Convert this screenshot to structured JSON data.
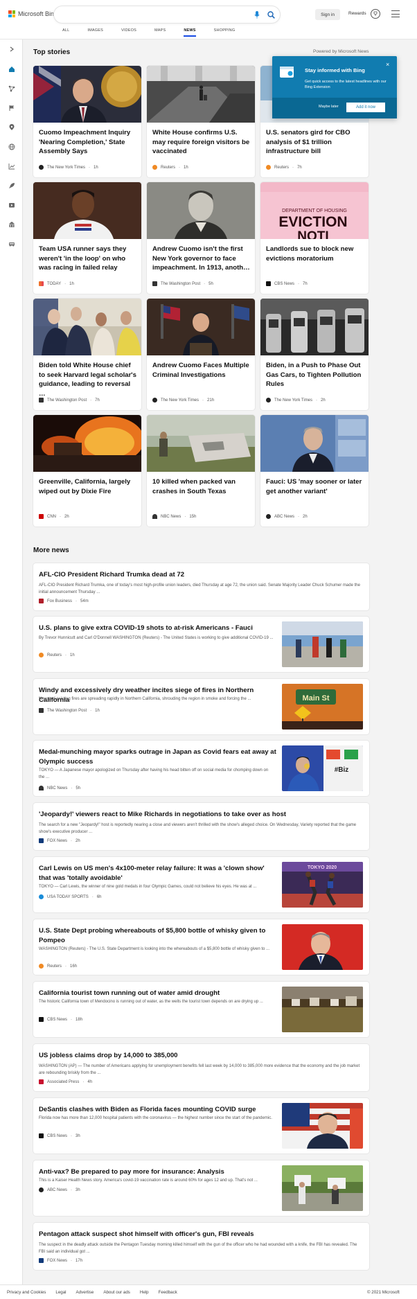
{
  "header": {
    "logo_text": "Microsoft Bing",
    "signin_label": "Sign in",
    "rewards_label": "Rewards",
    "tabs": [
      "ALL",
      "IMAGES",
      "VIDEOS",
      "MAPS",
      "NEWS",
      "SHOPPING"
    ],
    "active_tab": "NEWS"
  },
  "sections": {
    "top_stories": "Top stories",
    "powered_by": "Powered by Microsoft News",
    "more_news": "More news"
  },
  "promo": {
    "title": "Stay informed with Bing",
    "description": "Get quick access to the latest headlines with our Bing Extension",
    "later_label": "Maybe later",
    "add_label": "Add it now",
    "close_label": "×"
  },
  "top_stories": [
    {
      "title": "Cuomo Impeachment Inquiry 'Nearing Completion,' State Assembly Says",
      "source": "The New York Times",
      "age": "1h"
    },
    {
      "title": "White House confirms U.S. may require foreign visitors be vaccinated",
      "source": "Reuters",
      "age": "1h"
    },
    {
      "title": "U.S. senators gird for CBO analysis of $1 trillion infrastructure bill",
      "source": "Reuters",
      "age": "7h"
    },
    {
      "title": "Team USA runner says they weren't 'in the loop' on who was racing in failed relay",
      "source": "TODAY",
      "age": "1h"
    },
    {
      "title": "Andrew Cuomo isn't the first New York governor to face impeachment. In 1913, anoth…",
      "source": "The Washington Post",
      "age": "5h"
    },
    {
      "title": "Landlords sue to block new evictions moratorium",
      "source": "CBS News",
      "age": "7h"
    },
    {
      "title": "Biden told White House chief to seek Harvard legal scholar's guidance, leading to reversal …",
      "source": "The Washington Post",
      "age": "7h"
    },
    {
      "title": "Andrew Cuomo Faces Multiple Criminal Investigations",
      "source": "The New York Times",
      "age": "21h"
    },
    {
      "title": "Biden, in a Push to Phase Out Gas Cars, to Tighten Pollution Rules",
      "source": "The New York Times",
      "age": "2h"
    },
    {
      "title": "Greenville, California, largely wiped out by Dixie Fire",
      "source": "CNN",
      "age": "2h"
    },
    {
      "title": "10 killed when packed van crashes in South Texas",
      "source": "NBC News",
      "age": "15h"
    },
    {
      "title": "Fauci: US 'may sooner or later get another variant'",
      "source": "ABC News",
      "age": "2h"
    }
  ],
  "image_text": {
    "eviction_header": "DEPARTMENT OF HOUSING",
    "eviction_word": "EVICTION",
    "eviction_word2": "NOTI",
    "main_sign": "Main St",
    "biz_sign": "#Biz",
    "tokyo_banner": "TOKYO 2020"
  },
  "more_news": [
    {
      "title": "AFL-CIO President Richard Trumka dead at 72",
      "desc": "AFL-CIO President Richard Trumka, one of today's most high-profile union leaders, died Thursday at age 72, the union said. Senate Majority Leader Chuck Schumer made the initial announcement Thursday ...",
      "source": "Fox Business",
      "age": "54m"
    },
    {
      "title": "U.S. plans to give extra COVID-19 shots to at-risk Americans - Fauci",
      "desc": "By Trevor Hunnicutt and Carl O'Donnell WASHINGTON (Reuters) - The United States is working to give additional COVID-19 ...",
      "source": "Reuters",
      "age": "1h"
    },
    {
      "title": "Windy and excessively dry weather incites siege of fires in Northern California",
      "desc": "New and existing fires are spreading rapidly in Northern California, shrouding the region in smoke and forcing the ...",
      "source": "The Washington Post",
      "age": "1h"
    },
    {
      "title": "Medal-munching mayor sparks outrage in Japan as Covid fears eat away at Olympic success",
      "desc": "TOKYO — A Japanese mayor apologized on Thursday after having his head bitten off on social media for chomping down on the ...",
      "source": "NBC News",
      "age": "5h"
    },
    {
      "title": "'Jeopardy!' viewers react to Mike Richards in negotiations to take over as host",
      "desc": "The search for a new \"Jeopardy!\" host is reportedly nearing a close and viewers aren't thrilled with the show's alleged choice. On Wednesday, Variety reported that the game show's executive producer ...",
      "source": "FOX News",
      "age": "2h"
    },
    {
      "title": "Carl Lewis on US men's 4x100-meter relay failure: It was a 'clown show' that was 'totally avoidable'",
      "desc": "TOKYO — Carl Lewis, the winner of nine gold medals in four Olympic Games, could not believe his eyes. He was at ...",
      "source": "USA TODAY SPORTS",
      "age": "6h"
    },
    {
      "title": "U.S. State Dept probing whereabouts of $5,800 bottle of whisky given to Pompeo",
      "desc": "WASHINGTON (Reuters) - The U.S. State Department is looking into the whereabouts of a $5,800 bottle of whisky given to ...",
      "source": "Reuters",
      "age": "16h"
    },
    {
      "title": "California tourist town running out of water amid drought",
      "desc": "The historic California town of Mendocino is running out of water, as the wells the tourist town depends on are drying up ...",
      "source": "CBS News",
      "age": "18h"
    },
    {
      "title": "US jobless claims drop by 14,000 to 385,000",
      "desc": "WASHINGTON (AP) — The number of Americans applying for unemployment benefits fell last week by 14,000 to 385,000 more evidence that the economy and the job market are rebounding briskly from the ...",
      "source": "Associated Press",
      "age": "4h"
    },
    {
      "title": "DeSantis clashes with Biden as Florida faces mounting COVID surge",
      "desc": "Florida now has more than 12,000 hospital patients with the coronavirus — the highest number since the start of the pandemic.",
      "source": "CBS News",
      "age": "3h"
    },
    {
      "title": "Anti-vax? Be prepared to pay more for insurance: Analysis",
      "desc": "This is a Kaiser Health News story. America's covid-19 vaccination rate is around 60% for ages 12 and up. That's not ...",
      "source": "ABC News",
      "age": "3h"
    },
    {
      "title": "Pentagon attack suspect shot himself with officer's gun, FBI reveals",
      "desc": "The suspect in the deadly attack outside the Pentagon Tuesday morning killed himself with the gun of the officer who he had wounded with a knife, the FBI has revealed. The FBI said an individual got ...",
      "source": "FOX News",
      "age": "17h"
    }
  ],
  "footer": {
    "links": [
      "Privacy and Cookies",
      "Legal",
      "Advertise",
      "About our ads",
      "Help",
      "Feedback"
    ],
    "copyright": "© 2021 Microsoft"
  },
  "icons": {
    "rail": [
      "expand-icon",
      "home-icon",
      "globe-network-icon",
      "flag-icon",
      "location-pin-icon",
      "world-icon",
      "business-chart-icon",
      "rocket-icon",
      "entertainment-icon",
      "building-icon",
      "car-icon"
    ]
  },
  "colors": {
    "accent": "#174ae4",
    "promo_bg": "#117cb0",
    "rail_active": "#117cb0"
  }
}
